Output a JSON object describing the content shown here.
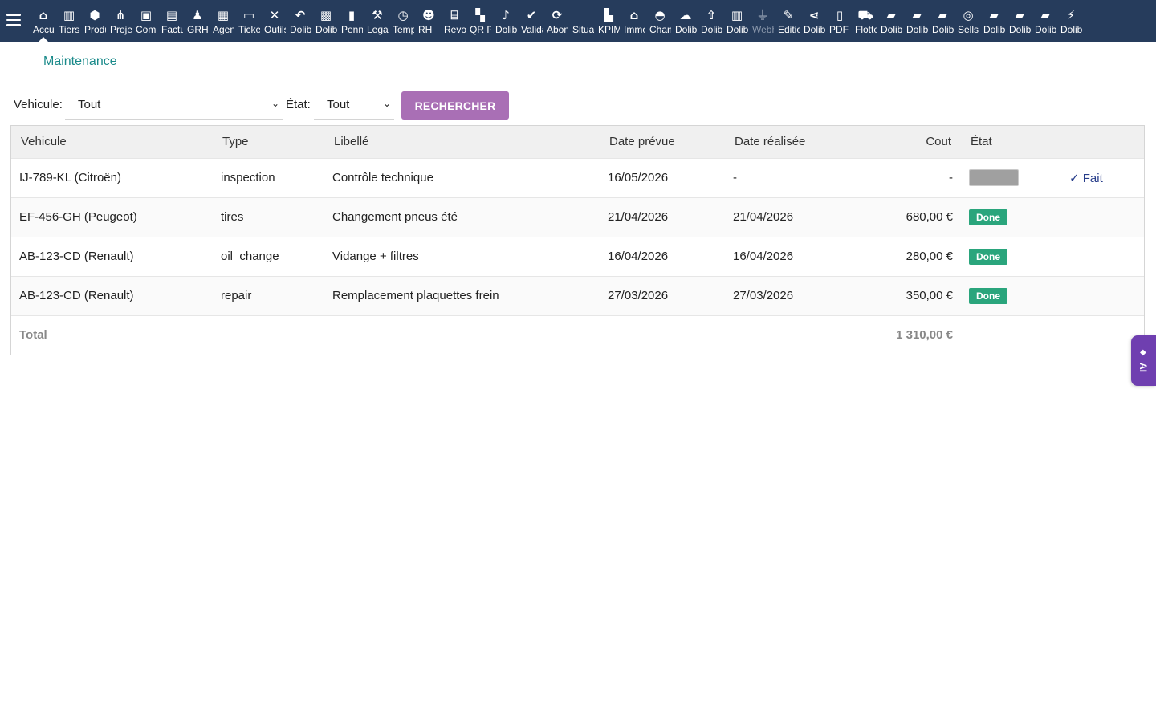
{
  "topbar": {
    "menu_items": [
      {
        "name": "home-icon",
        "icon": "⌂",
        "label": "Accueil"
      },
      {
        "name": "building-icon",
        "icon": "▥",
        "label": "Tiers"
      },
      {
        "name": "cube-icon",
        "icon": "⬢",
        "label": "Produits"
      },
      {
        "name": "project-icon",
        "icon": "⋔",
        "label": "Projets"
      },
      {
        "name": "briefcase-icon",
        "icon": "▣",
        "label": "Commercial"
      },
      {
        "name": "invoice-icon",
        "icon": "▤",
        "label": "Facturation"
      },
      {
        "name": "user-icon",
        "icon": "♟",
        "label": "GRH"
      },
      {
        "name": "calendar-icon",
        "icon": "▦",
        "label": "Agenda"
      },
      {
        "name": "ticket-icon",
        "icon": "▭",
        "label": "Tickets"
      },
      {
        "name": "tools-icon",
        "icon": "✕",
        "label": "Outils"
      },
      {
        "name": "undo-icon",
        "icon": "↶",
        "label": "Dolibarr"
      },
      {
        "name": "case-icon",
        "icon": "▩",
        "label": "Dolibarr"
      },
      {
        "name": "doc-icon",
        "icon": "▮",
        "label": "Penn"
      },
      {
        "name": "gavel-icon",
        "icon": "⚒",
        "label": "Legal"
      },
      {
        "name": "clock-icon",
        "icon": "◷",
        "label": "Temps"
      },
      {
        "name": "users-icon",
        "icon": "☻",
        "label": "RH"
      },
      {
        "name": "bank-icon",
        "icon": "⌸",
        "label": "Revo"
      },
      {
        "name": "qrcode-icon",
        "icon": "▚",
        "label": "QR Pay"
      },
      {
        "name": "bell-icon",
        "icon": "♪",
        "label": "Dolibarr"
      },
      {
        "name": "check-icon",
        "icon": "✔",
        "label": "Validation"
      },
      {
        "name": "refresh-icon",
        "icon": "⟳",
        "label": "Abonnements"
      },
      {
        "name": "situation-icon",
        "icon": "",
        "label": "Situations"
      },
      {
        "name": "chart-icon",
        "icon": "▙",
        "label": "KPIMax"
      },
      {
        "name": "house-icon",
        "icon": "⌂",
        "label": "Immobilier"
      },
      {
        "name": "helmet-icon",
        "icon": "◓",
        "label": "Chantiers"
      },
      {
        "name": "cloud-icon",
        "icon": "☁",
        "label": "Dolibarr"
      },
      {
        "name": "upload-icon",
        "icon": "⇧",
        "label": "Dolibarr"
      },
      {
        "name": "tower-icon",
        "icon": "▥",
        "label": "Dolibarr"
      },
      {
        "name": "plug-icon",
        "icon": "⏚",
        "label": "Webhooks"
      },
      {
        "name": "edit-icon",
        "icon": "✎",
        "label": "Edition"
      },
      {
        "name": "share-icon",
        "icon": "⋖",
        "label": "Dolibarr"
      },
      {
        "name": "pdf-icon",
        "icon": "▯",
        "label": "PDF"
      },
      {
        "name": "car-icon",
        "icon": "⛟",
        "label": "Flotte"
      },
      {
        "name": "note-icon",
        "icon": "▰",
        "label": "Dolibarr"
      },
      {
        "name": "note-icon",
        "icon": "▰",
        "label": "Dolibarr"
      },
      {
        "name": "note-icon",
        "icon": "▰",
        "label": "Dolibarr"
      },
      {
        "name": "handshake-icon",
        "icon": "◎",
        "label": "Sells"
      },
      {
        "name": "note-icon",
        "icon": "▰",
        "label": "Dolibarr"
      },
      {
        "name": "note-icon",
        "icon": "▰",
        "label": "Dolibarr"
      },
      {
        "name": "note-icon",
        "icon": "▰",
        "label": "Dolibarr"
      },
      {
        "name": "wand-icon",
        "icon": "⚡",
        "label": "Dolibarr"
      }
    ]
  },
  "breadcrumb": "Maintenance",
  "filters": {
    "vehicle_label": "Vehicule:",
    "vehicle_value": "Tout",
    "state_label": "État:",
    "state_value": "Tout",
    "search_button": "RECHERCHER"
  },
  "table": {
    "headers": [
      "Vehicule",
      "Type",
      "Libellé",
      "Date prévue",
      "Date réalisée",
      "Cout",
      "État",
      ""
    ],
    "rows": [
      {
        "vehicle": "IJ-789-KL (Citroën)",
        "type": "inspection",
        "label": "Contrôle technique",
        "planned": "16/05/2026",
        "done": "-",
        "cost": "-",
        "state": "",
        "action": "✓ Fait"
      },
      {
        "vehicle": "EF-456-GH (Peugeot)",
        "type": "tires",
        "label": "Changement pneus été",
        "planned": "21/04/2026",
        "done": "21/04/2026",
        "cost": "680,00 €",
        "state": "Done",
        "action": ""
      },
      {
        "vehicle": "AB-123-CD (Renault)",
        "type": "oil_change",
        "label": "Vidange + filtres",
        "planned": "16/04/2026",
        "done": "16/04/2026",
        "cost": "280,00 €",
        "state": "Done",
        "action": ""
      },
      {
        "vehicle": "AB-123-CD (Renault)",
        "type": "repair",
        "label": "Remplacement plaquettes frein",
        "planned": "27/03/2026",
        "done": "27/03/2026",
        "cost": "350,00 €",
        "state": "Done",
        "action": ""
      }
    ],
    "total_label": "Total",
    "total_value": "1 310,00 €"
  },
  "ai_tab": {
    "icon": "◆",
    "label": "AI"
  },
  "colors": {
    "topbar": "#263c5c",
    "accent": "#a96fb5",
    "done_badge": "#2aa57c",
    "breadcrumb": "#1a8a8a",
    "ai_tab": "#6f3fb0"
  }
}
